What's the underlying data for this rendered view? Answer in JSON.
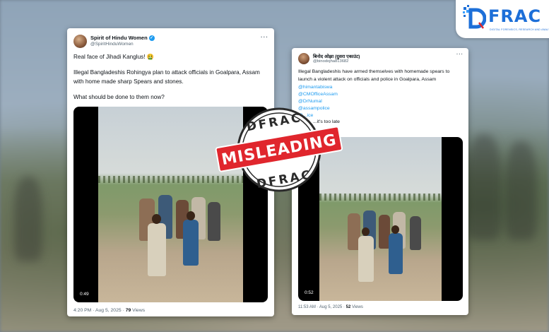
{
  "logo": {
    "text": "FRAC",
    "subtitle": "DIGITAL FORENSICS, RESEARCH AND ANALYTICS CENTRE"
  },
  "stamp": {
    "top_text": "DFRAC",
    "banner": "MISLEADING",
    "bottom_text": "DFRAC",
    "color": "#e0262d"
  },
  "tweet_left": {
    "name": "Spirit of Hindu Women",
    "verified_icon": "verified-badge-icon",
    "handle": "@SpiritHinduWomen",
    "more": "···",
    "line1": "Real face of Jihadi Kanglus! 🤮",
    "line2": "Illegal Bangladeshis Rohingya plan to attack officials in Goalpara, Assam",
    "line3": "with home made sharp Spears and stones.",
    "line4": "What should be done to them now?",
    "video_time": "0:49",
    "timestamp": "4:20 PM · Aug 5, 2025 · ",
    "views_count": "79",
    "views_label": " Views"
  },
  "tweet_right": {
    "name": "बिनोद ओझा (दुसरा एकाउंट)",
    "handle": "@binodojha813682",
    "more": "···",
    "line1": "Illegal Bangladeshis have armed themselves with homemade spears to",
    "line2": "launch a violent attack on officials and police in Goalpara, Assam",
    "mentions": [
      "@himantabiswa",
      "@CMOfficeAssam",
      "@DrNumal",
      "@assampolice",
      "@...ice"
    ],
    "line_end": "...it's too late",
    "video_time": "0:52",
    "timestamp": "11:53 AM · Aug 5, 2025 · ",
    "views_count": "52",
    "views_label": " Views"
  }
}
